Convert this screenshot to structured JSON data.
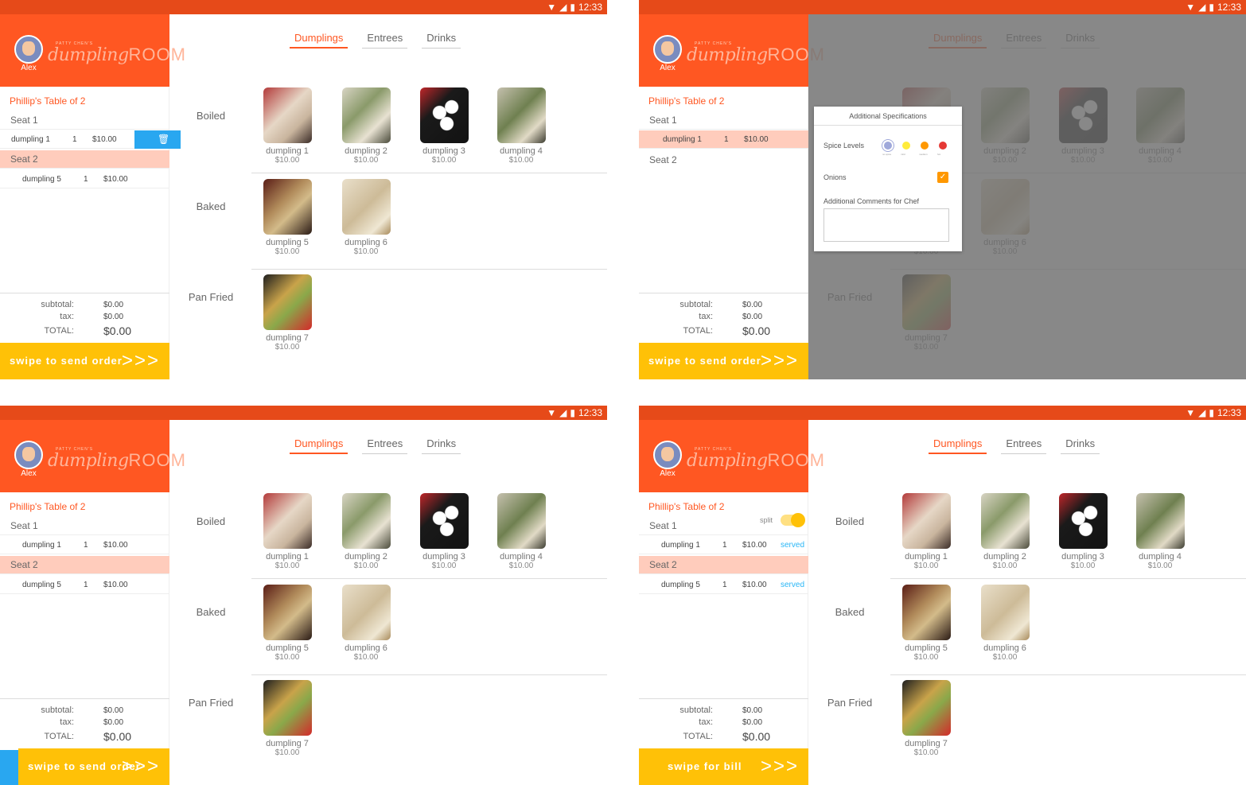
{
  "status": {
    "time": "12:33",
    "wifi_icon": "wifi-icon",
    "signal_icon": "signal-icon",
    "battery_icon": "battery-icon"
  },
  "brand": {
    "user": "Alex",
    "logo_small": "PATTY CHEN'S",
    "logo_script": "dumpling",
    "logo_caps": "ROOM"
  },
  "order": {
    "table_title": "Phillip's Table of 2",
    "seat1": "Seat 1",
    "seat2": "Seat 2",
    "split_label": "split",
    "served_label": "served",
    "item_a": {
      "name": "dumpling 1",
      "qty": "1",
      "price": "$10.00"
    },
    "item_b": {
      "name": "dumpling 5",
      "qty": "1",
      "price": "$10.00"
    },
    "subtotal_label": "subtotal:",
    "tax_label": "tax:",
    "total_label": "TOTAL:",
    "subtotal": "$0.00",
    "tax": "$0.00",
    "total": "$0.00",
    "swipe_order": "swipe to send order",
    "swipe_bill": "swipe for bill",
    "arrows": ">>>"
  },
  "tabs": [
    "Dumplings",
    "Entrees",
    "Drinks"
  ],
  "categories": [
    "Boiled",
    "Baked",
    "Pan Fried"
  ],
  "menu": [
    {
      "name": "dumpling 1",
      "price": "$10.00"
    },
    {
      "name": "dumpling 2",
      "price": "$10.00"
    },
    {
      "name": "dumpling 3",
      "price": "$10.00"
    },
    {
      "name": "dumpling 4",
      "price": "$10.00"
    },
    {
      "name": "dumpling 5",
      "price": "$10.00"
    },
    {
      "name": "dumpling 6",
      "price": "$10.00"
    },
    {
      "name": "dumpling 7",
      "price": "$10.00"
    }
  ],
  "popup": {
    "title": "Additional Specifications",
    "spice_label": "Spice Levels",
    "spice_options": [
      "no spice",
      "mild",
      "medium",
      "hot"
    ],
    "spice_colors": [
      "#9fa8da",
      "#ffeb3b",
      "#ff9800",
      "#e53935"
    ],
    "onions_label": "Onions",
    "onions_checked": true,
    "comments_label": "Additional Comments for Chef"
  },
  "colors": {
    "statusbar": "#e64a19",
    "brand": "#ff5722",
    "accent": "#ff5722",
    "swipe": "#ffc107",
    "delete": "#29a7f0",
    "selected_seat": "#ffccbc"
  }
}
